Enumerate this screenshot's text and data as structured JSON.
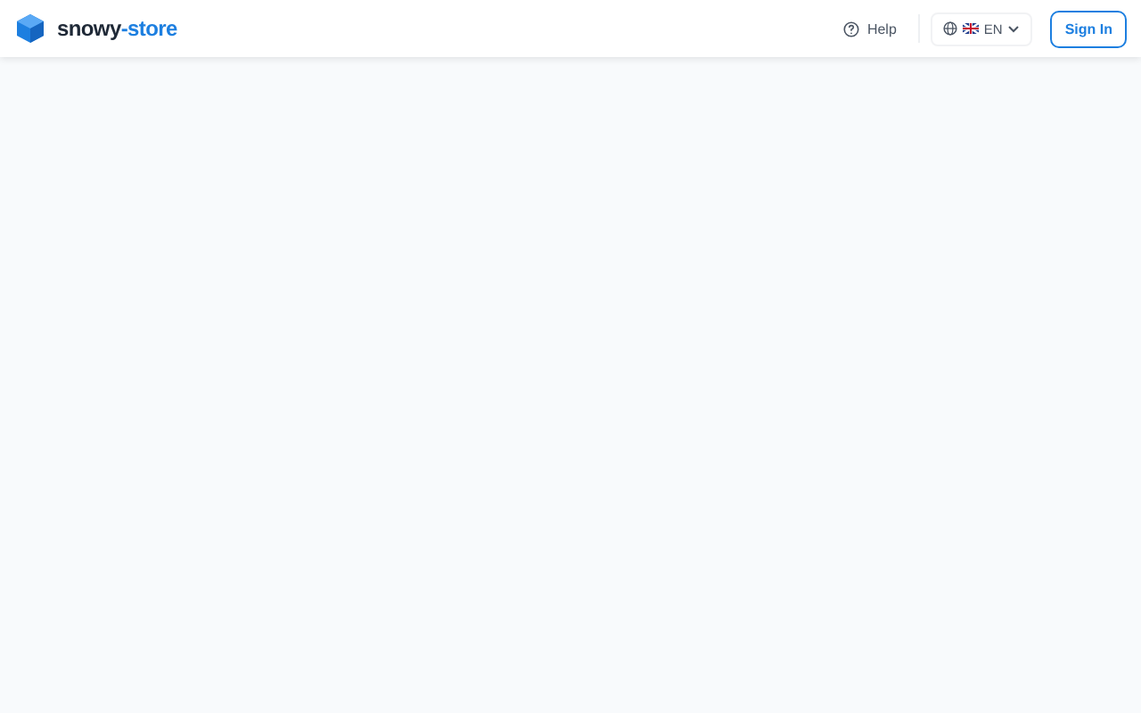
{
  "header": {
    "brand": {
      "name": "snowy",
      "suffix": "-store"
    },
    "help": "Help",
    "language": {
      "code": "EN"
    },
    "sign_in": "Sign In"
  }
}
